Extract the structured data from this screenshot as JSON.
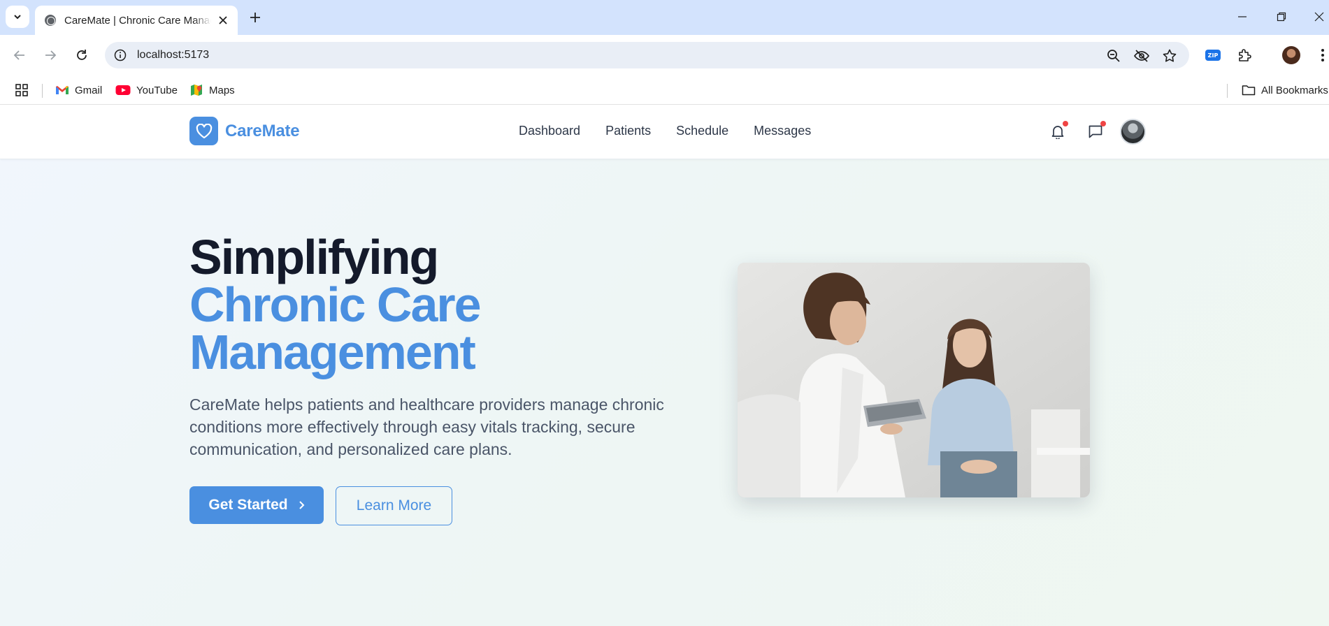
{
  "browser": {
    "tab_title": "CareMate | Chronic Care Management",
    "url": "localhost:5173",
    "bookmarks": [
      {
        "label": "Gmail",
        "icon": "gmail-icon"
      },
      {
        "label": "YouTube",
        "icon": "youtube-icon"
      },
      {
        "label": "Maps",
        "icon": "maps-icon"
      }
    ],
    "all_bookmarks": "All Bookmarks",
    "extension_badge": "ZIP"
  },
  "header": {
    "brand": "CareMate",
    "nav": [
      "Dashboard",
      "Patients",
      "Schedule",
      "Messages"
    ]
  },
  "hero": {
    "title_line1": "Simplifying",
    "title_line2": "Chronic Care",
    "title_line3": "Management",
    "description": "CareMate helps patients and healthcare providers manage chronic conditions more effectively through easy vitals tracking, secure communication, and personalized care plans.",
    "primary_cta": "Get Started",
    "secondary_cta": "Learn More"
  },
  "colors": {
    "accent": "#4a8fe0",
    "heading": "#141a2b",
    "notification_dot": "#ef4444",
    "browser_frame": "#d3e3fd"
  }
}
